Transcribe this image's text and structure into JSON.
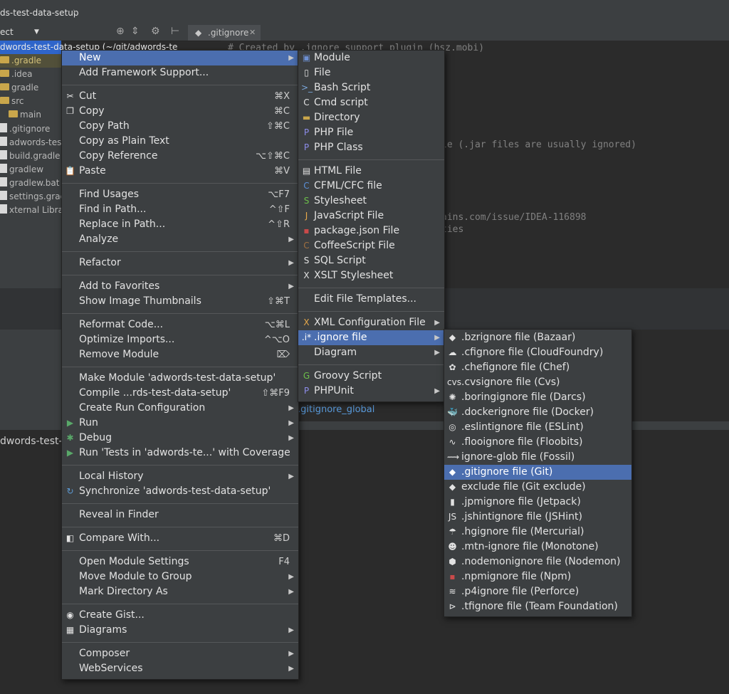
{
  "breadcrumb": "ds-test-data-setup",
  "project_selector": "ect",
  "tab_label": ".gitignore",
  "tree": {
    "header": "dwords-test-data-setup (~/git/adwords-te",
    "items": [
      ".gradle",
      ".idea",
      "gradle",
      "src",
      "main",
      ".gitignore",
      "adwords-test",
      "build.gradle",
      "gradlew",
      "gradlew.bat",
      "settings.grad",
      "xternal Librarie"
    ]
  },
  "editor": {
    "line1": "# Created by .ignore support plugin (hsz.mobi)",
    "line2": "le (.jar files are usually ignored)",
    "line3": "ains.com/issue/IDEA-116898",
    "line4": "ties"
  },
  "status_link": ".gitignore_global",
  "lower_text": "dwords-test-",
  "context_menu": [
    {
      "label": "New",
      "arrow": true,
      "selected": true
    },
    {
      "label": "Add Framework Support..."
    },
    {
      "sep": true
    },
    {
      "label": "Cut",
      "shortcut": "⌘X",
      "icon": "scissors-icon"
    },
    {
      "label": "Copy",
      "shortcut": "⌘C",
      "icon": "copy-icon"
    },
    {
      "label": "Copy Path",
      "shortcut": "⇧⌘C"
    },
    {
      "label": "Copy as Plain Text"
    },
    {
      "label": "Copy Reference",
      "shortcut": "⌥⇧⌘C"
    },
    {
      "label": "Paste",
      "shortcut": "⌘V",
      "icon": "paste-icon"
    },
    {
      "sep": true
    },
    {
      "label": "Find Usages",
      "shortcut": "⌥F7"
    },
    {
      "label": "Find in Path...",
      "shortcut": "^⇧F"
    },
    {
      "label": "Replace in Path...",
      "shortcut": "^⇧R"
    },
    {
      "label": "Analyze",
      "arrow": true
    },
    {
      "sep": true
    },
    {
      "label": "Refactor",
      "arrow": true
    },
    {
      "sep": true
    },
    {
      "label": "Add to Favorites",
      "arrow": true
    },
    {
      "label": "Show Image Thumbnails",
      "shortcut": "⇧⌘T"
    },
    {
      "sep": true
    },
    {
      "label": "Reformat Code...",
      "shortcut": "⌥⌘L"
    },
    {
      "label": "Optimize Imports...",
      "shortcut": "^⌥O"
    },
    {
      "label": "Remove Module",
      "shortcut": "⌦"
    },
    {
      "sep": true
    },
    {
      "label": "Make Module 'adwords-test-data-setup'"
    },
    {
      "label": "Compile ...rds-test-data-setup'",
      "shortcut": "⇧⌘F9"
    },
    {
      "label": "Create Run Configuration",
      "arrow": true
    },
    {
      "label": "Run",
      "arrow": true,
      "icon": "run-icon"
    },
    {
      "label": "Debug",
      "arrow": true,
      "icon": "debug-icon"
    },
    {
      "label": "Run 'Tests in 'adwords-te...' with Coverage",
      "icon": "coverage-icon"
    },
    {
      "sep": true
    },
    {
      "label": "Local History",
      "arrow": true
    },
    {
      "label": "Synchronize 'adwords-test-data-setup'",
      "icon": "sync-icon"
    },
    {
      "sep": true
    },
    {
      "label": "Reveal in Finder"
    },
    {
      "sep": true
    },
    {
      "label": "Compare With...",
      "shortcut": "⌘D",
      "icon": "compare-icon"
    },
    {
      "sep": true
    },
    {
      "label": "Open Module Settings",
      "shortcut": "F4"
    },
    {
      "label": "Move Module to Group",
      "arrow": true
    },
    {
      "label": "Mark Directory As",
      "arrow": true
    },
    {
      "sep": true
    },
    {
      "label": "Create Gist...",
      "icon": "github-icon"
    },
    {
      "label": "Diagrams",
      "arrow": true,
      "icon": "diagram-icon"
    },
    {
      "sep": true
    },
    {
      "label": "Composer",
      "arrow": true
    },
    {
      "label": "WebServices",
      "arrow": true
    }
  ],
  "new_menu": [
    {
      "label": "Module",
      "icon": "module-icon"
    },
    {
      "label": "File",
      "icon": "file-icon"
    },
    {
      "label": "Bash Script",
      "icon": "bash-icon"
    },
    {
      "label": "Cmd script",
      "icon": "cmd-icon"
    },
    {
      "label": "Directory",
      "icon": "folder-icon"
    },
    {
      "label": "PHP File",
      "icon": "php-icon"
    },
    {
      "label": "PHP Class",
      "icon": "php-class-icon"
    },
    {
      "sep": true
    },
    {
      "label": "HTML File",
      "icon": "html-icon"
    },
    {
      "label": "CFML/CFC file",
      "icon": "cfml-icon"
    },
    {
      "label": "Stylesheet",
      "icon": "css-icon"
    },
    {
      "label": "JavaScript File",
      "icon": "js-icon"
    },
    {
      "label": "package.json File",
      "icon": "npm-icon"
    },
    {
      "label": "CoffeeScript File",
      "icon": "coffee-icon"
    },
    {
      "label": "SQL Script",
      "icon": "sql-icon"
    },
    {
      "label": "XSLT Stylesheet",
      "icon": "xslt-icon"
    },
    {
      "sep": true
    },
    {
      "label": "Edit File Templates..."
    },
    {
      "sep": true
    },
    {
      "label": "XML Configuration File",
      "arrow": true,
      "icon": "xml-icon"
    },
    {
      "label": ".ignore file",
      "arrow": true,
      "selected": true,
      "icon": "ignore-icon"
    },
    {
      "label": "Diagram",
      "arrow": true
    },
    {
      "sep": true
    },
    {
      "label": "Groovy Script",
      "icon": "groovy-icon"
    },
    {
      "label": "PHPUnit",
      "arrow": true,
      "icon": "phpunit-icon"
    }
  ],
  "ignore_menu": [
    {
      "label": ".bzrignore file (Bazaar)",
      "icon": "bazaar-icon"
    },
    {
      "label": ".cfignore file (CloudFoundry)",
      "icon": "cloudfoundry-icon"
    },
    {
      "label": ".chefignore file (Chef)",
      "icon": "chef-icon"
    },
    {
      "label": ".cvsignore file (Cvs)",
      "icon": "cvs-icon"
    },
    {
      "label": ".boringignore file (Darcs)",
      "icon": "darcs-icon"
    },
    {
      "label": ".dockerignore file (Docker)",
      "icon": "docker-icon"
    },
    {
      "label": ".eslintignore file (ESLint)",
      "icon": "eslint-icon"
    },
    {
      "label": ".flooignore file (Floobits)",
      "icon": "floobits-icon"
    },
    {
      "label": "ignore-glob file (Fossil)",
      "icon": "fossil-icon"
    },
    {
      "label": ".gitignore file (Git)",
      "icon": "git-icon",
      "selected": true
    },
    {
      "label": "exclude file (Git exclude)",
      "icon": "git-exclude-icon"
    },
    {
      "label": ".jpmignore file (Jetpack)",
      "icon": "jetpack-icon"
    },
    {
      "label": ".jshintignore file (JSHint)",
      "icon": "jshint-icon"
    },
    {
      "label": ".hgignore file (Mercurial)",
      "icon": "mercurial-icon"
    },
    {
      "label": ".mtn-ignore file (Monotone)",
      "icon": "monotone-icon"
    },
    {
      "label": ".nodemonignore file (Nodemon)",
      "icon": "nodemon-icon"
    },
    {
      "label": ".npmignore file (Npm)",
      "icon": "npm-icon"
    },
    {
      "label": ".p4ignore file (Perforce)",
      "icon": "perforce-icon"
    },
    {
      "label": ".tfignore file (Team Foundation)",
      "icon": "teamfoundation-icon"
    }
  ],
  "icon_glyphs": {
    "scissors-icon": "✂",
    "copy-icon": "❐",
    "paste-icon": "📋",
    "run-icon": "▶",
    "debug-icon": "✱",
    "coverage-icon": "▶",
    "sync-icon": "↻",
    "compare-icon": "◧",
    "github-icon": "◉",
    "diagram-icon": "▦",
    "module-icon": "▣",
    "file-icon": "▯",
    "bash-icon": ">_",
    "cmd-icon": "C",
    "folder-icon": "▬",
    "php-icon": "P",
    "php-class-icon": "P",
    "html-icon": "▤",
    "cfml-icon": "C",
    "css-icon": "S",
    "js-icon": "J",
    "npm-icon": "▪",
    "coffee-icon": "C",
    "sql-icon": "S",
    "xslt-icon": "X",
    "xml-icon": "X",
    "ignore-icon": ".i*",
    "groovy-icon": "G",
    "phpunit-icon": "P",
    "bazaar-icon": "◆",
    "cloudfoundry-icon": "☁",
    "chef-icon": "✿",
    "cvs-icon": "cvs",
    "darcs-icon": "✺",
    "docker-icon": "🐳",
    "eslint-icon": "◎",
    "floobits-icon": "∿",
    "fossil-icon": "⟿",
    "git-icon": "◆",
    "git-exclude-icon": "◆",
    "jetpack-icon": "▮",
    "jshint-icon": "JS",
    "mercurial-icon": "☂",
    "monotone-icon": "☻",
    "nodemon-icon": "⬢",
    "perforce-icon": "≋",
    "teamfoundation-icon": "⊳"
  },
  "icon_colors": {
    "run-icon": "#59a869",
    "debug-icon": "#59a869",
    "coverage-icon": "#59a869",
    "sync-icon": "#5c9bd6",
    "groovy-icon": "#6cbf4a",
    "bash-icon": "#7aa6da",
    "php-icon": "#8c8ce8",
    "php-class-icon": "#8c8ce8",
    "npm-icon": "#c94a4a",
    "js-icon": "#e8a94b",
    "css-icon": "#6cbf4a",
    "cfml-icon": "#5a8fd6",
    "xml-icon": "#e8a94b",
    "coffee-icon": "#a07040",
    "folder-icon": "#c9a64b",
    "module-icon": "#6d8fd1",
    "phpunit-icon": "#8c8ce8"
  }
}
